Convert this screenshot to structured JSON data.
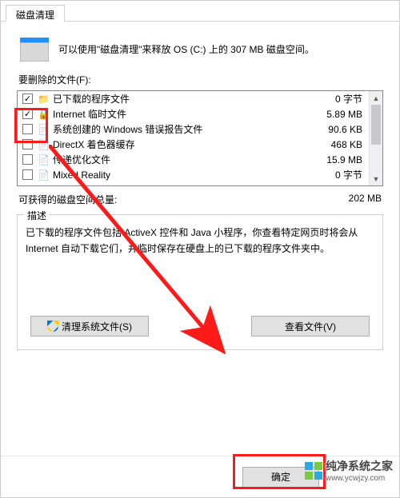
{
  "tab": {
    "label": "磁盘清理"
  },
  "intro": "可以使用\"磁盘清理\"来释放 OS (C:) 上的 307 MB 磁盘空间。",
  "files_label": "要删除的文件(F):",
  "items": [
    {
      "checked": true,
      "icon": "📁",
      "name": "已下载的程序文件",
      "size": "0 字节"
    },
    {
      "checked": true,
      "icon": "🔒",
      "name": "Internet 临时文件",
      "size": "5.89 MB"
    },
    {
      "checked": false,
      "icon": "📄",
      "name": "系统创建的 Windows 错误报告文件",
      "size": "90.6 KB"
    },
    {
      "checked": false,
      "icon": "📄",
      "name": "DirectX 着色器缓存",
      "size": "468 KB"
    },
    {
      "checked": false,
      "icon": "📄",
      "name": "传递优化文件",
      "size": "15.9 MB"
    },
    {
      "checked": false,
      "icon": "📄",
      "name": "Mixed Reality",
      "size": "0 字节"
    }
  ],
  "total": {
    "label": "可获得的磁盘空间总量:",
    "value": "202 MB"
  },
  "desc": {
    "legend": "描述",
    "body": "已下载的程序文件包括 ActiveX 控件和 Java 小程序，你查看特定网页时将会从 Internet 自动下载它们，并临时保存在硬盘上的已下载的程序文件夹中。"
  },
  "buttons": {
    "cleanSystem": "清理系统文件(S)",
    "viewFiles": "查看文件(V)",
    "ok": "确定"
  },
  "watermark": {
    "text": "纯净系统之家",
    "url": "www.ycwjzy.com"
  }
}
